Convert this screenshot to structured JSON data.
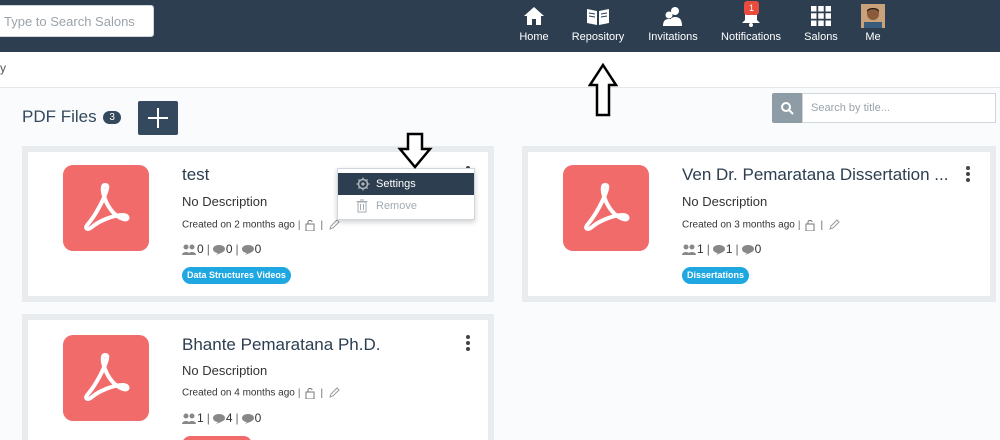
{
  "search_salons": {
    "placeholder": "Type to Search Salons"
  },
  "nav": {
    "home": {
      "label": "Home",
      "icon": "home-icon"
    },
    "repository": {
      "label": "Repository",
      "icon": "book-icon"
    },
    "invitations": {
      "label": "Invitations",
      "icon": "people-icon"
    },
    "notifications": {
      "label": "Notifications",
      "icon": "bell-icon",
      "badge": "1"
    },
    "salons": {
      "label": "Salons",
      "icon": "grid-icon"
    },
    "me": {
      "label": "Me",
      "icon": "avatar"
    }
  },
  "breadcrumb": "y",
  "files": {
    "heading": "PDF Files",
    "count": "3",
    "search_placeholder": "Search by title..."
  },
  "cards": [
    {
      "title": "test",
      "description": "No Description",
      "created": "Created on 2 months ago",
      "members": "0",
      "comments": "0",
      "chats": "0",
      "tag": "Data Structures Videos"
    },
    {
      "title": "Ven Dr. Pemaratana Dissertation ...",
      "description": "No Description",
      "created": "Created on 3 months ago",
      "members": "1",
      "comments": "1",
      "chats": "0",
      "tag": "Dissertations"
    },
    {
      "title": "Bhante Pemaratana Ph.D.",
      "description": "No Description",
      "created": "Created on 4 months ago",
      "members": "1",
      "comments": "4",
      "chats": "0",
      "tag": ""
    }
  ],
  "menu": {
    "settings": "Settings",
    "remove": "Remove"
  },
  "colors": {
    "navbar": "#2d3e50",
    "pdf_tile": "#f26b6b",
    "tag": "#1ea7e1",
    "badge": "#e74c3c"
  }
}
